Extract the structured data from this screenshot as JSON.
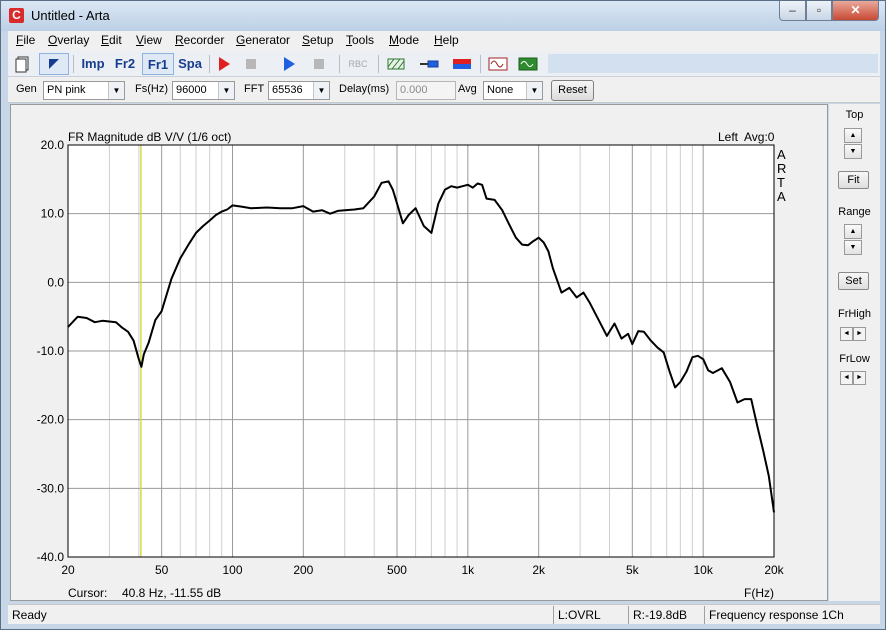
{
  "window": {
    "title": "Untitled - Arta",
    "icon_letter": "C",
    "min_symbol": "–",
    "max_symbol": "▫",
    "close_symbol": "✕"
  },
  "menu": [
    {
      "u": "F",
      "rest": "ile"
    },
    {
      "u": "O",
      "rest": "verlay"
    },
    {
      "u": "E",
      "rest": "dit"
    },
    {
      "u": "V",
      "rest": "iew"
    },
    {
      "u": "R",
      "rest": "ecorder"
    },
    {
      "u": "G",
      "rest": "enerator"
    },
    {
      "u": "S",
      "rest": "etup"
    },
    {
      "u": "T",
      "rest": "ools"
    },
    {
      "u": "M",
      "rest": "ode"
    },
    {
      "u": "H",
      "rest": "elp"
    }
  ],
  "toolbar": {
    "imp": "Imp",
    "fr2": "Fr2",
    "fr1": "Fr1",
    "spa": "Spa",
    "rbc": "RBC"
  },
  "params": {
    "gen_label": "Gen",
    "gen_value": "PN pink",
    "fs_label": "Fs(Hz)",
    "fs_value": "96000",
    "fft_label": "FFT",
    "fft_value": "65536",
    "delay_label": "Delay(ms)",
    "delay_value": "0.000",
    "avg_label": "Avg",
    "avg_value": "None",
    "reset_label": "Reset"
  },
  "chart_data": {
    "type": "line",
    "title": "FR Magnitude dB V/V (1/6 oct)",
    "channel_label": "Left",
    "avg_label": "Avg:0",
    "watermark": [
      "A",
      "R",
      "T",
      "A"
    ],
    "xlabel": "F(Hz)",
    "x_scale": "log",
    "xlim": [
      20,
      20000
    ],
    "ylim": [
      -40,
      20
    ],
    "x_ticks": [
      20,
      50,
      100,
      200,
      500,
      1000,
      2000,
      5000,
      10000,
      20000
    ],
    "x_tick_labels": [
      "20",
      "50",
      "100",
      "200",
      "500",
      "1k",
      "2k",
      "5k",
      "10k",
      "20k"
    ],
    "y_ticks": [
      20,
      10,
      0,
      -10,
      -20,
      -30,
      -40
    ],
    "y_tick_labels": [
      "20.0",
      "10.0",
      "0.0",
      "-10.0",
      "-20.0",
      "-30.0",
      "-40.0"
    ],
    "grid": true,
    "cursor_freq": 40.8,
    "cursor_text": "Cursor:",
    "cursor_value": "40.8 Hz, -11.55 dB",
    "series": [
      {
        "color": "#000000",
        "x": [
          20,
          22,
          24,
          26,
          28,
          30,
          32,
          34,
          36,
          38,
          40,
          41,
          42,
          44,
          47,
          50,
          55,
          60,
          65,
          70,
          75,
          80,
          85,
          90,
          95,
          100,
          110,
          120,
          140,
          160,
          180,
          200,
          220,
          240,
          260,
          280,
          300,
          330,
          360,
          400,
          430,
          460,
          480,
          500,
          530,
          560,
          600,
          650,
          700,
          750,
          800,
          850,
          900,
          950,
          1000,
          1050,
          1100,
          1150,
          1200,
          1300,
          1400,
          1500,
          1600,
          1700,
          1800,
          1900,
          2000,
          2100,
          2200,
          2300,
          2500,
          2700,
          2900,
          3100,
          3300,
          3600,
          3900,
          4200,
          4500,
          4800,
          5000,
          5300,
          5600,
          6000,
          6400,
          6800,
          7200,
          7600,
          8000,
          8500,
          9000,
          9500,
          10000,
          10500,
          11000,
          12000,
          13000,
          14000,
          15000,
          16000,
          17000,
          18000,
          19000,
          20000
        ],
        "y": [
          -6.5,
          -5,
          -5.2,
          -5.8,
          -5.6,
          -5.7,
          -5.8,
          -6.6,
          -7.2,
          -8.5,
          -11.2,
          -12.3,
          -10.5,
          -8.8,
          -5.5,
          -4.2,
          0.5,
          3.5,
          5.5,
          7.2,
          8.2,
          9,
          9.8,
          10.3,
          10.6,
          11.2,
          11,
          10.8,
          10.9,
          10.8,
          10.8,
          11.1,
          10.3,
          10.5,
          10,
          10.4,
          10.5,
          10.6,
          10.8,
          12.5,
          14.5,
          14.7,
          13.5,
          11.5,
          8.6,
          9.8,
          10.8,
          8.2,
          7.2,
          11.5,
          13.5,
          14,
          13.8,
          14,
          14.2,
          13.8,
          14.4,
          14.2,
          12.2,
          12,
          10.5,
          8.4,
          6.5,
          5.5,
          5.4,
          6,
          6.5,
          5.8,
          4.5,
          2,
          -1.5,
          -0.8,
          -2.2,
          -1.5,
          -3,
          -5.5,
          -7.8,
          -6,
          -8.2,
          -7.5,
          -9,
          -7.1,
          -7.2,
          -8.5,
          -9.5,
          -10.2,
          -13,
          -15.3,
          -14.5,
          -13,
          -10.9,
          -10.7,
          -11.2,
          -12.8,
          -13.2,
          -12.5,
          -14.5,
          -17.5,
          -17,
          -17,
          -21,
          -24.5,
          -28.2,
          -33.5
        ]
      }
    ],
    "cursor_color": "#d8d84a"
  },
  "right_panel": {
    "top_label": "Top",
    "fit_label": "Fit",
    "range_label": "Range",
    "set_label": "Set",
    "frhigh_label": "FrHigh",
    "frlow_label": "FrLow",
    "up_symbol": "▲",
    "down_symbol": "▼",
    "left_symbol": "◄",
    "right_symbol": "►"
  },
  "status": {
    "ready": "Ready",
    "left": "L:OVRL",
    "right": "R:-19.8dB",
    "mode": "Frequency response 1Ch"
  }
}
